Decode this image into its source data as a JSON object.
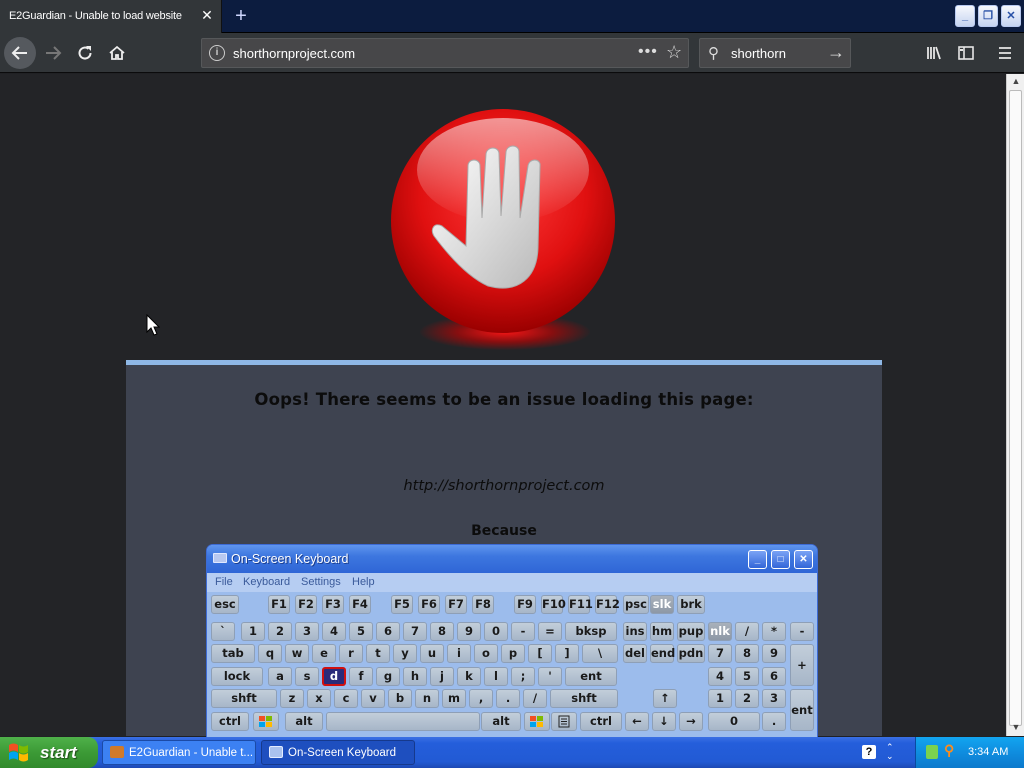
{
  "browser": {
    "tab_title": "E2Guardian - Unable to load website",
    "tab_close": "✕",
    "new_tab": "+",
    "url": "shorthornproject.com",
    "search_query": "shorthorn",
    "window_buttons": {
      "minimize": "_",
      "restore": "❐",
      "close": "✕"
    }
  },
  "page": {
    "heading": "Oops! There seems to be an issue loading this page:",
    "blocked_url": "http://shorthornproject.com",
    "because_label": "Because",
    "icon": "stop-hand-icon",
    "colors": {
      "stop_red": "#e01010",
      "panel": "#3e4350",
      "panel_border": "#8fb8e6",
      "page_bg": "#232427"
    }
  },
  "osk": {
    "title": "On-Screen Keyboard",
    "menu": [
      "File",
      "Keyboard",
      "Settings",
      "Help"
    ],
    "selected_key": "d",
    "rows": [
      [
        "esc",
        "F1",
        "F2",
        "F3",
        "F4",
        "F5",
        "F6",
        "F7",
        "F8",
        "F9",
        "F10",
        "F11",
        "F12",
        "psc",
        "slk",
        "brk"
      ],
      [
        "`",
        "1",
        "2",
        "3",
        "4",
        "5",
        "6",
        "7",
        "8",
        "9",
        "0",
        "-",
        "=",
        "bksp",
        "ins",
        "hm",
        "pup",
        "nlk",
        "/",
        "*",
        "-"
      ],
      [
        "tab",
        "q",
        "w",
        "e",
        "r",
        "t",
        "y",
        "u",
        "i",
        "o",
        "p",
        "[",
        "]",
        "\\",
        "del",
        "end",
        "pdn",
        "7",
        "8",
        "9",
        "+"
      ],
      [
        "lock",
        "a",
        "s",
        "d",
        "f",
        "g",
        "h",
        "j",
        "k",
        "l",
        ";",
        "'",
        "ent",
        "4",
        "5",
        "6"
      ],
      [
        "shft",
        "z",
        "x",
        "c",
        "v",
        "b",
        "n",
        "m",
        ",",
        ".",
        "/",
        "shft",
        "↑",
        "1",
        "2",
        "3",
        "ent"
      ],
      [
        "ctrl",
        "alt",
        "alt",
        "ctrl",
        "←",
        "↓",
        "→",
        "0",
        "."
      ]
    ]
  },
  "taskbar": {
    "start_label": "start",
    "items": [
      "E2Guardian - Unable t...",
      "On-Screen Keyboard"
    ],
    "clock": "3:34 AM"
  }
}
